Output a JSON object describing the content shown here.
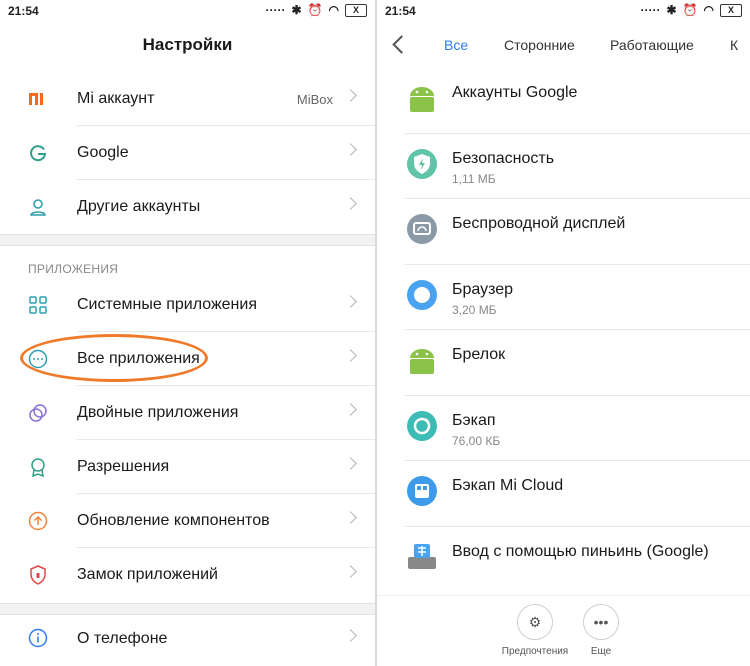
{
  "left": {
    "status": {
      "time": "21:54",
      "battery": "X"
    },
    "title": "Настройки",
    "accounts": [
      {
        "label": "Mi аккаунт",
        "value": "MiBox",
        "icon": "mi-logo-icon"
      },
      {
        "label": "Google",
        "value": "",
        "icon": "google-g-icon"
      },
      {
        "label": "Другие аккаунты",
        "value": "",
        "icon": "person-icon"
      }
    ],
    "apps_section": "ПРИЛОЖЕНИЯ",
    "apps": [
      {
        "label": "Системные приложения",
        "icon": "grid-icon"
      },
      {
        "label": "Все приложения",
        "icon": "more-dots-icon"
      },
      {
        "label": "Двойные приложения",
        "icon": "dual-circles-icon"
      },
      {
        "label": "Разрешения",
        "icon": "badge-icon"
      },
      {
        "label": "Обновление компонентов",
        "icon": "upload-icon"
      },
      {
        "label": "Замок приложений",
        "icon": "shield-lock-icon"
      }
    ],
    "about": {
      "label": "О телефоне",
      "icon": "info-icon"
    },
    "colors": {
      "icon": "#2f9fb0",
      "annotation": "#ee7a2a"
    }
  },
  "right": {
    "status": {
      "time": "21:54",
      "battery": "X"
    },
    "tabs": [
      "Все",
      "Сторонние",
      "Работающие",
      "К"
    ],
    "active_tab": "Все",
    "apps": [
      {
        "name": "Аккаунты Google",
        "size": "",
        "icon": "android-icon"
      },
      {
        "name": "Безопасность",
        "size": "1,11 МБ",
        "icon": "security-shield-icon"
      },
      {
        "name": "Беспроводной дисплей",
        "size": "",
        "icon": "wireless-display-icon"
      },
      {
        "name": "Браузер",
        "size": "3,20 МБ",
        "icon": "browser-icon"
      },
      {
        "name": "Брелок",
        "size": "",
        "icon": "android-icon"
      },
      {
        "name": "Бэкап",
        "size": "76,00 КБ",
        "icon": "backup-icon"
      },
      {
        "name": "Бэкап Mi Cloud",
        "size": "",
        "icon": "mi-cloud-icon"
      },
      {
        "name": "Ввод с помощью пиньинь (Google)",
        "size": "",
        "icon": "pinyin-keyboard-icon"
      }
    ],
    "bottom": {
      "prefs": "Предпочтения",
      "more": "Еще"
    },
    "colors": {
      "active_tab": "#2f7cf6",
      "android": "#8bc34a"
    }
  }
}
